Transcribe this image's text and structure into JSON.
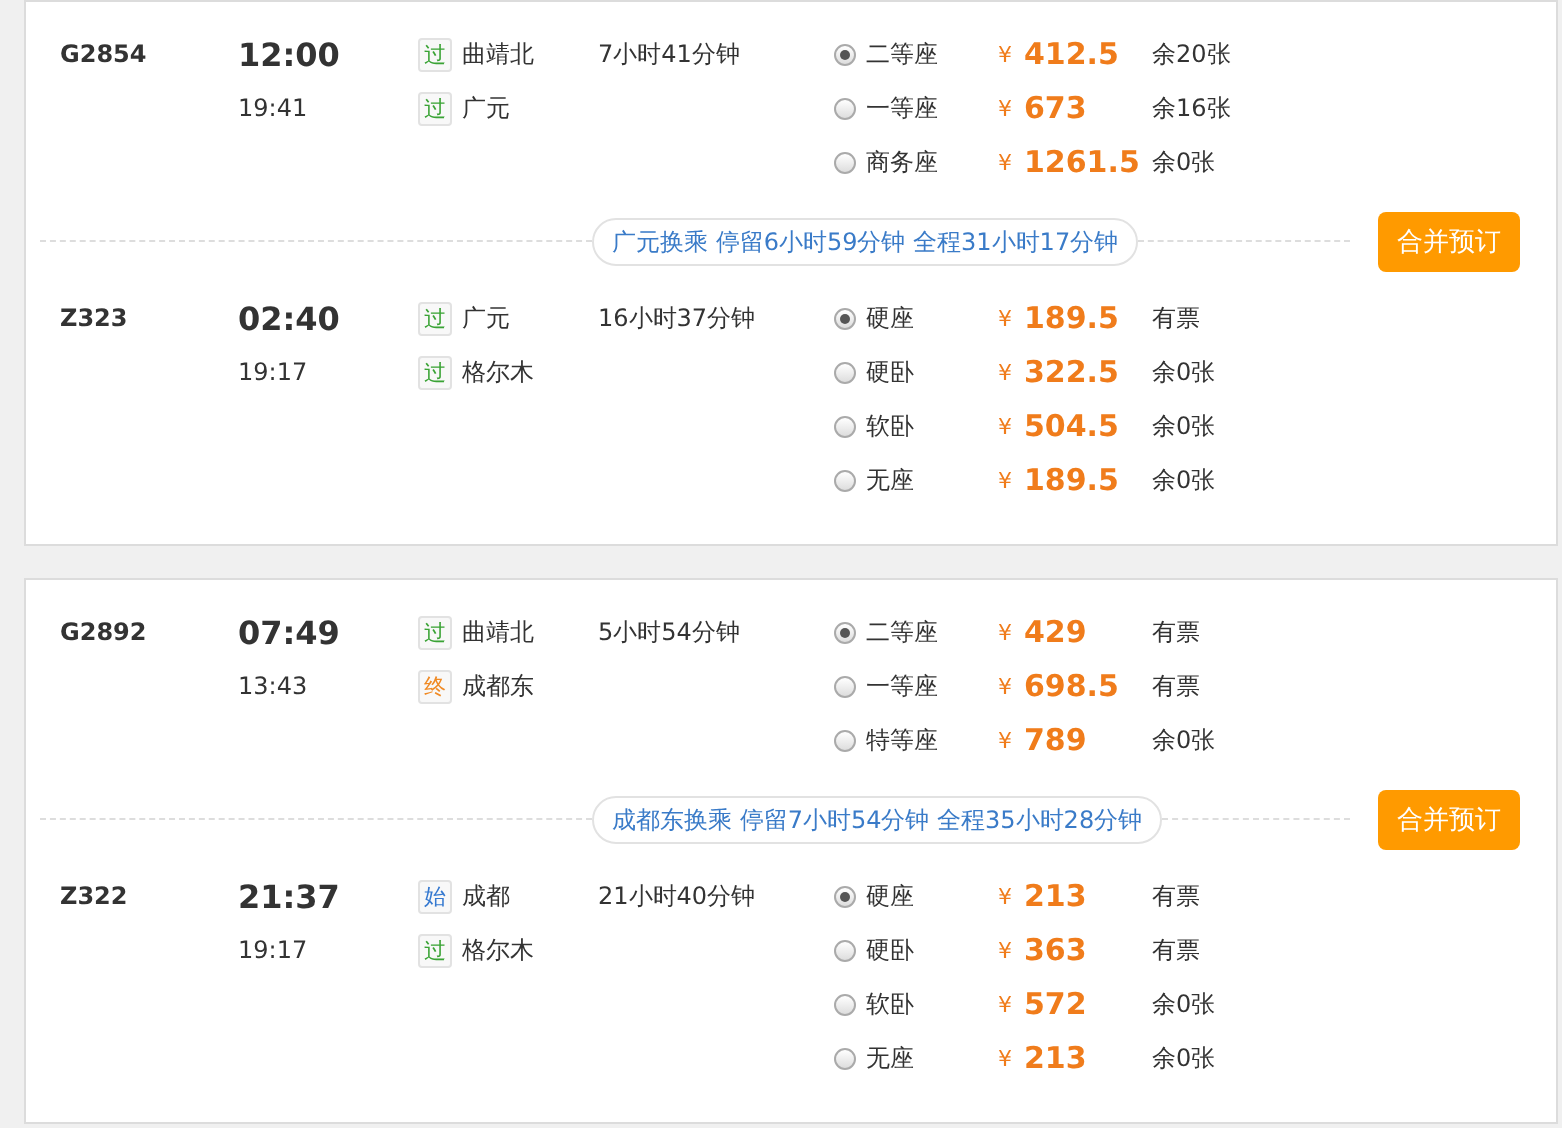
{
  "itineraries": [
    {
      "legs": [
        {
          "train": "G2854",
          "depart": "12:00",
          "arrive": "19:41",
          "from": {
            "tag": "过",
            "kind": "pass",
            "name": "曲靖北"
          },
          "to": {
            "tag": "过",
            "kind": "pass",
            "name": "广元"
          },
          "duration": "7小时41分钟",
          "seats": [
            {
              "name": "二等座",
              "selected": true,
              "currency": "¥",
              "price": "412.5",
              "availability": "余20张"
            },
            {
              "name": "一等座",
              "selected": false,
              "currency": "¥",
              "price": "673",
              "availability": "余16张"
            },
            {
              "name": "商务座",
              "selected": false,
              "currency": "¥",
              "price": "1261.5",
              "availability": "余0张"
            }
          ]
        },
        {
          "train": "Z323",
          "depart": "02:40",
          "arrive": "19:17",
          "from": {
            "tag": "过",
            "kind": "pass",
            "name": "广元"
          },
          "to": {
            "tag": "过",
            "kind": "pass",
            "name": "格尔木"
          },
          "duration": "16小时37分钟",
          "seats": [
            {
              "name": "硬座",
              "selected": true,
              "currency": "¥",
              "price": "189.5",
              "availability": "有票"
            },
            {
              "name": "硬卧",
              "selected": false,
              "currency": "¥",
              "price": "322.5",
              "availability": "余0张"
            },
            {
              "name": "软卧",
              "selected": false,
              "currency": "¥",
              "price": "504.5",
              "availability": "余0张"
            },
            {
              "name": "无座",
              "selected": false,
              "currency": "¥",
              "price": "189.5",
              "availability": "余0张"
            }
          ]
        }
      ],
      "transfer": "广元换乘 停留6小时59分钟 全程31小时17分钟",
      "button": "合并预订"
    },
    {
      "legs": [
        {
          "train": "G2892",
          "depart": "07:49",
          "arrive": "13:43",
          "from": {
            "tag": "过",
            "kind": "pass",
            "name": "曲靖北"
          },
          "to": {
            "tag": "终",
            "kind": "end",
            "name": "成都东"
          },
          "duration": "5小时54分钟",
          "seats": [
            {
              "name": "二等座",
              "selected": true,
              "currency": "¥",
              "price": "429",
              "availability": "有票"
            },
            {
              "name": "一等座",
              "selected": false,
              "currency": "¥",
              "price": "698.5",
              "availability": "有票"
            },
            {
              "name": "特等座",
              "selected": false,
              "currency": "¥",
              "price": "789",
              "availability": "余0张"
            }
          ]
        },
        {
          "train": "Z322",
          "depart": "21:37",
          "arrive": "19:17",
          "from": {
            "tag": "始",
            "kind": "start",
            "name": "成都"
          },
          "to": {
            "tag": "过",
            "kind": "pass",
            "name": "格尔木"
          },
          "duration": "21小时40分钟",
          "seats": [
            {
              "name": "硬座",
              "selected": true,
              "currency": "¥",
              "price": "213",
              "availability": "有票"
            },
            {
              "name": "硬卧",
              "selected": false,
              "currency": "¥",
              "price": "363",
              "availability": "有票"
            },
            {
              "name": "软卧",
              "selected": false,
              "currency": "¥",
              "price": "572",
              "availability": "余0张"
            },
            {
              "name": "无座",
              "selected": false,
              "currency": "¥",
              "price": "213",
              "availability": "余0张"
            }
          ]
        }
      ],
      "transfer": "成都东换乘 停留7小时54分钟 全程35小时28分钟",
      "button": "合并预订"
    }
  ]
}
